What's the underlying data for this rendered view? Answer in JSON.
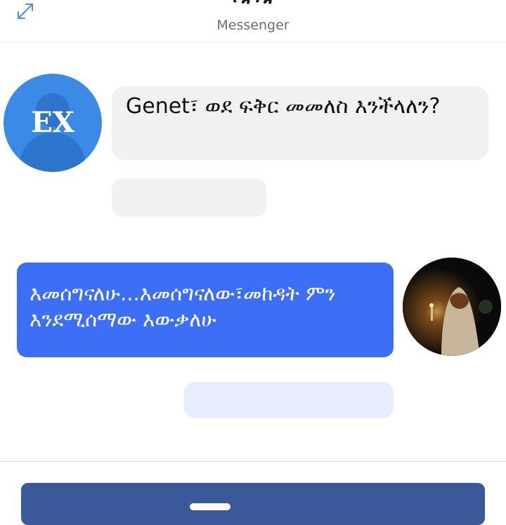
{
  "header": {
    "title": "የቋንቋ",
    "subtitle": "Messenger"
  },
  "messages": [
    {
      "sender": "contact",
      "avatar_label": "EX",
      "text": "Genet፣ ወደ ፍቅር መመለስ እንችላለን?"
    },
    {
      "sender": "me",
      "text": "እመሰግናለሁ...እመሰግናለው፣መከዳት ምን እንደሚሰማው እውቃለሁ"
    }
  ],
  "colors": {
    "incoming_bubble": "#f1f1f1",
    "outgoing_bubble": "#3c6ff6",
    "contact_avatar": "#3b8ae6",
    "header_action": "#3b5998"
  },
  "icons": {
    "expand": "expand-arrows-icon"
  }
}
